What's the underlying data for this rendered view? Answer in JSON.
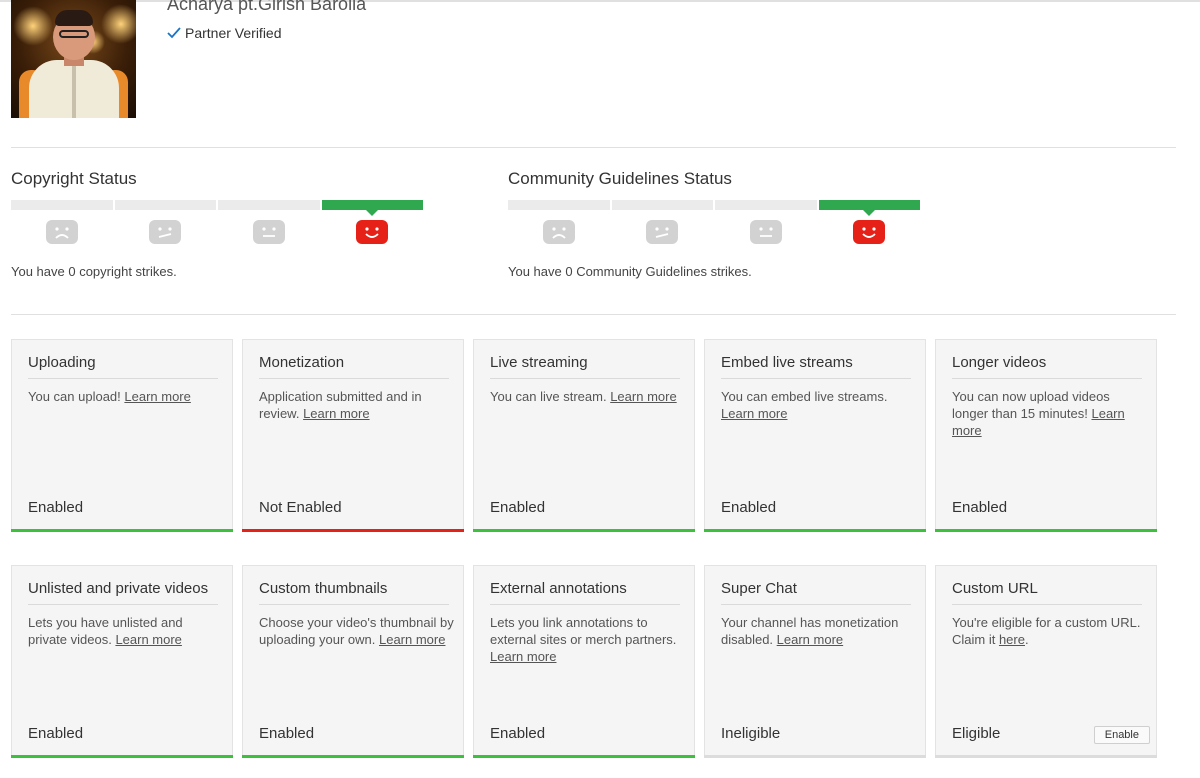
{
  "header": {
    "channel_name": "Acharya pt.Girish Barolia",
    "verified_label": "Partner Verified"
  },
  "copyright": {
    "title": "Copyright Status",
    "strikes_text": "You have 0 copyright strikes.",
    "levels": [
      "sad-face-icon",
      "unsure-face-icon",
      "neutral-face-icon",
      "happy-face-icon"
    ],
    "active_level": 3
  },
  "community": {
    "title": "Community Guidelines Status",
    "strikes_text": "You have 0 Community Guidelines strikes.",
    "levels": [
      "sad-face-icon",
      "unsure-face-icon",
      "neutral-face-icon",
      "happy-face-icon"
    ],
    "active_level": 3
  },
  "colors": {
    "enabled": "#3cc13c",
    "not_enabled": "#e62117",
    "inactive": "#dcdcdc",
    "status_good": "#2fa84f",
    "face_active": "#e62117"
  },
  "features": [
    {
      "title": "Uploading",
      "desc": "You can upload!",
      "link": "Learn more",
      "status": "Enabled"
    },
    {
      "title": "Monetization",
      "desc": "Application submitted and in review.",
      "link": "Learn more",
      "status": "Not Enabled"
    },
    {
      "title": "Live streaming",
      "desc": "You can live stream.",
      "link": "Learn more",
      "status": "Enabled"
    },
    {
      "title": "Embed live streams",
      "desc": "You can embed live streams.",
      "link": "Learn more",
      "status": "Enabled"
    },
    {
      "title": "Longer videos",
      "desc": "You can now upload videos longer than 15 minutes!",
      "link": "Learn more",
      "status": "Enabled"
    },
    {
      "title": "Unlisted and private videos",
      "desc": "Lets you have unlisted and private videos.",
      "link": "Learn more",
      "status": "Enabled"
    },
    {
      "title": "Custom thumbnails",
      "desc": "Choose your video's thumbnail by uploading your own.",
      "link": "Learn more",
      "status": "Enabled"
    },
    {
      "title": "External annotations",
      "desc": "Lets you link annotations to external sites or merch partners.",
      "link": "Learn more",
      "status": "Enabled"
    },
    {
      "title": "Super Chat",
      "desc": "Your channel has monetization disabled.",
      "link": "Learn more",
      "status": "Ineligible"
    },
    {
      "title": "Custom URL",
      "desc": "You're eligible for a custom URL. Claim it",
      "link": "here",
      "desc_after": ".",
      "status": "Eligible",
      "button": "Enable"
    }
  ]
}
